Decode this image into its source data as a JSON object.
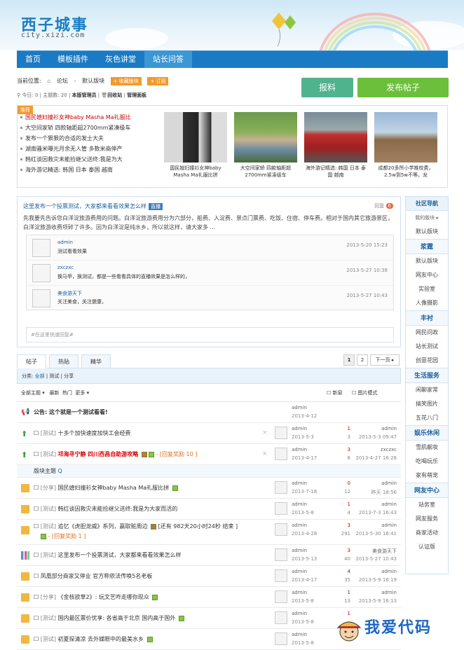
{
  "header": {
    "title": "西子城事",
    "subtitle": "city.xizi.com"
  },
  "nav": [
    "首页",
    "模板插件",
    "灰色讲堂",
    "站长问答"
  ],
  "crumb": {
    "label": "当前位置:",
    "forum": "论坛",
    "section": "默认版块",
    "fav": "+ 收藏版块",
    "sub": "+ 订阅"
  },
  "buttons": {
    "report": "报料",
    "post": "发布帖子"
  },
  "stats": {
    "today_label": "今日:",
    "today": "0",
    "topic_label": "主题数:",
    "topics": "20",
    "admin": "本版管理员",
    "recycle": "回收站",
    "panel": "管理面板"
  },
  "hot": {
    "badge": "推荐",
    "items": [
      "国民媳妇撞衫女神baby Masha Ma礼服比",
      "大空间家轿 四款轴距超2700mm紧凑级车",
      "发布一个狠狠的合适的发士大夫",
      "湖南骚米曝光月余无人管 多数米商停产",
      "韩红谈因救灾未能捡继父送终:我是为大",
      "海外游记精选: 韩国 日本 泰国 越南"
    ]
  },
  "pics": [
    {
      "cap": "国民媳妇撞衫女神baby Masha Ma礼服比拼"
    },
    {
      "cap": "大空间家轿 四款轴距超2700mm紧凑级车"
    },
    {
      "cap": "海外游记精选: 韩国 日本 泰国 越南"
    },
    {
      "cap": "成都20多所小学推校费，2.5w到5w不等。龙"
    }
  ],
  "post": {
    "title": "这里发布一个投票测试，大家都来看看效果怎么样",
    "badge": "直播",
    "reply_label": "回复",
    "reply_count": "6",
    "text": "先我要先告诉您白洋淀旅游费用的问题。白洋淀旅游费用分为六部分，船费、入淀费、景点门票费、吃饭、住宿、停车费。相对于国内其它旅游景区，白洋淀旅游收费项碎了许多。因为白洋淀是纯水乡，所以就这样，请大家多 ...",
    "comments": [
      {
        "name": "admin",
        "text": "测试看看效果",
        "date": "2013-5-20 15:23"
      },
      {
        "name": "zxczxc",
        "text": "换马甲，换测试，都是一些看看具体的直播效果是怎么样的，",
        "date": "2013-5-27 10:38"
      },
      {
        "name": "美食游天下",
        "text": "关注美食，关注健康，",
        "date": "2013-5-27 10:43"
      }
    ],
    "reply_ph": "#在这里快速回复#"
  },
  "tabs": [
    "帖子",
    "热贴",
    "精华"
  ],
  "pager": {
    "p1": "1",
    "p2": "2",
    "next": "下一页 ▸"
  },
  "filter": {
    "label": "分类:",
    "all": "全部",
    "c1": "测试",
    "c2": "分享"
  },
  "sorts": {
    "all": "全部主题 ▾",
    "latest": "最新",
    "hot": "热门",
    "more": "更多 ▾",
    "new": "新窗",
    "img": "图片模式"
  },
  "side": {
    "title": "社区导航",
    "my": "我的版块 ▸",
    "default": "默认版块",
    "sec1": "浆霆",
    "sec1_items": [
      "默认版块",
      "网友中心",
      "实验室",
      "人像摄影"
    ],
    "sec2": "丰衬",
    "sec2_items": [
      "网民问政",
      "站长测试",
      "创意花园"
    ],
    "sec3": "生活服务",
    "sec3_items": [
      "闲聊家常",
      "搞笑图片",
      "五花八门"
    ],
    "sec4": "娱乐休闲",
    "sec4_items": [
      "雪肌靓妆",
      "吃喝玩乐",
      "家有萌宠"
    ],
    "sec5": "网友中心",
    "sec5_items": [
      "站务室",
      "网友服务",
      "商家活动",
      "认证版"
    ]
  },
  "announce": {
    "text": "公告: 这个就是一个测试看看!",
    "author": "admin",
    "date": "2013-4-12"
  },
  "group_label": "版块主题",
  "topics_pinned": [
    {
      "cat": "[测试]",
      "title": "十多个加快速度加快工会经费",
      "author": "admin",
      "date": "2013-5-3",
      "reply": "1",
      "view": "3",
      "last": "admin",
      "ldate": "2013-5-3 09:47"
    },
    {
      "cat": "[测试]",
      "title": "邛海寻宁静 四川西昌自助游攻略",
      "extra": "- [回复奖励 10 ]",
      "author": "admin",
      "date": "2013-4-17",
      "reply": "3",
      "view": "6",
      "last": "zxczxc",
      "ldate": "2013-4-27 16:28"
    }
  ],
  "topics": [
    {
      "cat": "[分享]",
      "title": "国民媳妇撞衫女神baby Masha Ma礼服比拼",
      "author": "admin",
      "date": "2013-7-18",
      "reply": "0",
      "view": "12",
      "last": "admin",
      "ldate": "昨天 18:56"
    },
    {
      "cat": "[测试]",
      "title": "韩红谈因救灾未能捡继父送终:我是为大家而活的",
      "author": "admin",
      "date": "2013-5-8",
      "reply": "1",
      "view": "4",
      "last": "admin",
      "ldate": "2013-7-3 16:43"
    },
    {
      "cat": "[测试]",
      "title": "追忆《虎胆龙威》系列，赢取赃周边",
      "extra": "[还有 982天20小时24秒 结束 ]",
      "extra2": "- [回复奖励 1 ]",
      "author": "admin",
      "date": "2013-4-28",
      "reply": "3",
      "view": "291",
      "last": "admin",
      "ldate": "2013-5-30 16:41"
    },
    {
      "cat": "[测试]",
      "title": "这里发布一个投票测试，大家都来看看效果怎么样",
      "author": "admin",
      "date": "2013-5-13",
      "reply": "3",
      "view": "40",
      "last": "美食游天下",
      "ldate": "2013-5-27 10:43"
    },
    {
      "cat": "",
      "title": "凤凰部分商家又停业 官方称依法传唤5名老板",
      "author": "admin",
      "date": "2013-4-17",
      "reply": "4",
      "view": "35",
      "last": "admin",
      "ldate": "2013-5-9 16:19"
    },
    {
      "cat": "[分享]",
      "title": "《金核欲草2》: 玩文艺咋走哪你现众",
      "author": "admin",
      "date": "2013-5-8",
      "reply": "1",
      "view": "13",
      "last": "admin",
      "ldate": "2013-5-9 16:13"
    },
    {
      "cat": "[测试]",
      "title": "国内最区票价优享: 各省高于北京 国内高于国外",
      "author": "admin",
      "date": "2013-5-8",
      "reply": "1",
      "view": "",
      "last": "",
      "ldate": ""
    },
    {
      "cat": "[测试]",
      "title": "初夏探清凉 去外媒眼中的最美水乡",
      "author": "admin",
      "date": "2013-5-8",
      "reply": "",
      "view": "",
      "last": "",
      "ldate": ""
    }
  ],
  "watermark": "我爱代码",
  "colors": {
    "brand": "#1a7bc4",
    "green": "#6bbf3a",
    "teal": "#4fb38e"
  }
}
